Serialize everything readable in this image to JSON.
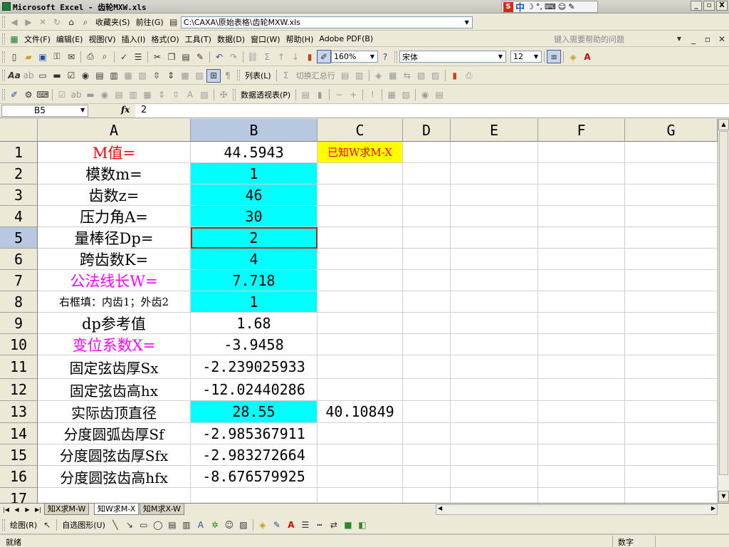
{
  "window": {
    "title": "Microsoft Excel - 齿轮MXW.xls",
    "ime": {
      "mode": "中",
      "punct": "°,"
    },
    "controls": {
      "minimize": "_",
      "restore": "▫",
      "close": "X"
    }
  },
  "toolbar_web": {
    "favorites": "收藏夹(S)",
    "goto": "前往(G)",
    "address": "C:\\CAXA\\原始表格\\齿轮MXW.xls"
  },
  "menu": {
    "items": [
      "文件(F)",
      "编辑(E)",
      "视图(V)",
      "插入(I)",
      "格式(O)",
      "工具(T)",
      "数据(D)",
      "窗口(W)",
      "帮助(H)",
      "Adobe PDF(B)"
    ],
    "help_placeholder": "键入需要帮助的问题"
  },
  "standard_toolbar": {
    "zoom": "160%",
    "font": "宋体",
    "font_size": "12"
  },
  "list_toolbar": {
    "list": "列表(L)",
    "toggle_total": "切换汇总行"
  },
  "pivot_toolbar": {
    "pivot": "数据透视表(P)"
  },
  "formula_bar": {
    "name_box": "B5",
    "fx": "fx",
    "value": "2"
  },
  "columns": [
    "A",
    "B",
    "C",
    "D",
    "E",
    "F",
    "G"
  ],
  "rows": [
    {
      "num": "1",
      "a": "M值=",
      "b": "44.5943",
      "c": "已知W求M-X"
    },
    {
      "num": "2",
      "a": "模数m=",
      "b": "1",
      "c": ""
    },
    {
      "num": "3",
      "a": "齿数z=",
      "b": "46",
      "c": ""
    },
    {
      "num": "4",
      "a": "压力角A=",
      "b": "30",
      "c": ""
    },
    {
      "num": "5",
      "a": "量棒径Dp=",
      "b": "2",
      "c": ""
    },
    {
      "num": "6",
      "a": "跨齿数K=",
      "b": "4",
      "c": ""
    },
    {
      "num": "7",
      "a": "公法线长W=",
      "b": "7.718",
      "c": ""
    },
    {
      "num": "8",
      "a": "右框填：内齿1；外齿2",
      "b": "1",
      "c": ""
    },
    {
      "num": "9",
      "a": "dp参考值",
      "b": "1.68",
      "c": ""
    },
    {
      "num": "10",
      "a": "变位系数X=",
      "b": "-3.9458",
      "c": ""
    },
    {
      "num": "11",
      "a": "固定弦齿厚Sx",
      "b": "-2.239025933",
      "c": ""
    },
    {
      "num": "12",
      "a": "固定弦齿高hx",
      "b": "-12.02440286",
      "c": ""
    },
    {
      "num": "13",
      "a": "实际齿顶直径",
      "b": "28.55",
      "c": "40.10849"
    },
    {
      "num": "14",
      "a": "分度圆弧齿厚Sf",
      "b": "-2.985367911",
      "c": ""
    },
    {
      "num": "15",
      "a": "分度圆弦齿厚Sfx",
      "b": "-2.983272664",
      "c": ""
    },
    {
      "num": "16",
      "a": "分度圆弦齿高hfx",
      "b": "-8.676579925",
      "c": ""
    },
    {
      "num": "17",
      "a": "",
      "b": "",
      "c": ""
    }
  ],
  "colors": {
    "red_text": "#ff0000",
    "magenta_text": "#ff00ff",
    "cyan_fill": "#00ffff",
    "yellow_fill": "#ffff00",
    "c1_text": "#ff0000"
  },
  "sheet_tabs": [
    "知X求M-W",
    "知W求M-X",
    "知M求X-W"
  ],
  "active_sheet": "知W求M-X",
  "drawing_toolbar": {
    "draw": "绘图(R)",
    "autoshapes": "自选图形(U)"
  },
  "status": {
    "ready": "就绪",
    "mode": "数字"
  }
}
